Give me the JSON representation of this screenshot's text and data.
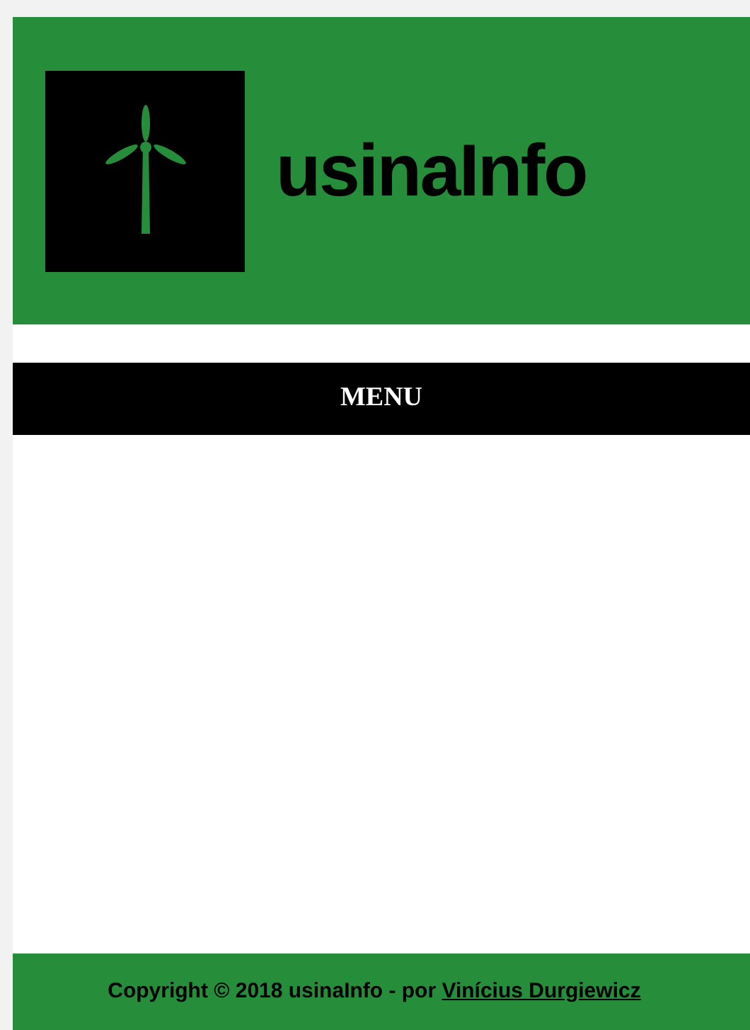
{
  "header": {
    "title": "usinaInfo"
  },
  "menu": {
    "label": "MENU"
  },
  "footer": {
    "text": "Copyright © 2018 usinaInfo - por",
    "link": "Vinícius Durgiewicz"
  }
}
